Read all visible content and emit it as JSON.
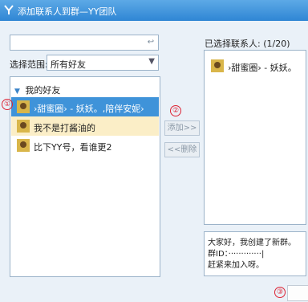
{
  "window": {
    "title": "添加联系人到群—YY团队"
  },
  "left": {
    "search_placeholder": "",
    "search_btn_glyph": "↩",
    "scope_label": "选择范围:",
    "scope_value": "所有好友",
    "group_label": "我的好友",
    "friends": [
      {
        "name": "›甜蜜圈›      - 妖妖。,陪伴安妮›"
      },
      {
        "name": "我不是打酱油的"
      },
      {
        "name": "比下YY号，看谁更2"
      }
    ]
  },
  "buttons": {
    "add": "添加>>",
    "remove": "<<删除"
  },
  "right": {
    "selected_label": "已选择联系人: (1/20)",
    "selected": [
      {
        "name": "›甜蜜圈›      - 妖妖。"
      }
    ],
    "message_lines": [
      "大家好，我创建了新群。",
      "群ID：·············|",
      "赶紧来加入呀。"
    ]
  },
  "markers": [
    "①",
    "②",
    "③"
  ],
  "icons": {
    "logo": "yy-logo-icon",
    "avatar": "avatar-icon"
  }
}
